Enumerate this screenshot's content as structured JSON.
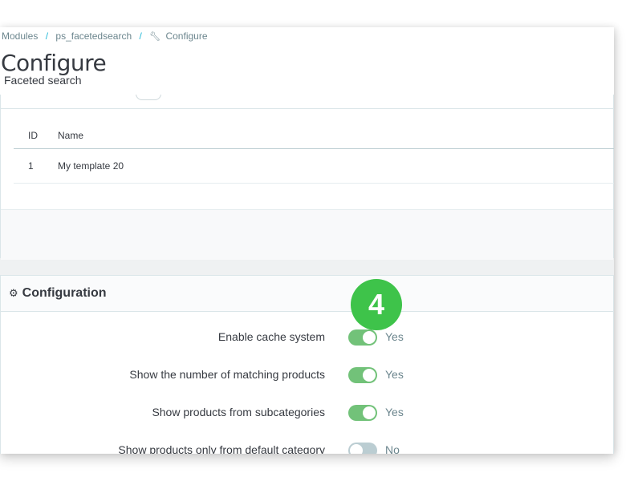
{
  "breadcrumb": {
    "items": [
      "Modules",
      "ps_facetedsearch",
      "Configure"
    ],
    "separator": "/"
  },
  "header": {
    "title": "Configure",
    "subtitle": "Faceted search"
  },
  "templates_table": {
    "columns": [
      "ID",
      "Name"
    ],
    "rows": [
      {
        "id": "1",
        "name": "My template 20"
      }
    ]
  },
  "config_panel": {
    "title": "Configuration",
    "options": [
      {
        "label": "Enable cache system",
        "state": "Yes",
        "enabled": true
      },
      {
        "label": "Show the number of matching products",
        "state": "Yes",
        "enabled": true
      },
      {
        "label": "Show products from subcategories",
        "state": "Yes",
        "enabled": true
      },
      {
        "label": "Show products only from default category",
        "state": "No",
        "enabled": false
      }
    ]
  },
  "step_badge": "4",
  "colors": {
    "accent": "#25b9d7",
    "switch_on": "#72c279",
    "switch_off": "#bbcdd2",
    "badge": "#3ec34a"
  },
  "icons": {
    "breadcrumb_current": "wrench-icon",
    "config_heading": "cogs-icon"
  }
}
